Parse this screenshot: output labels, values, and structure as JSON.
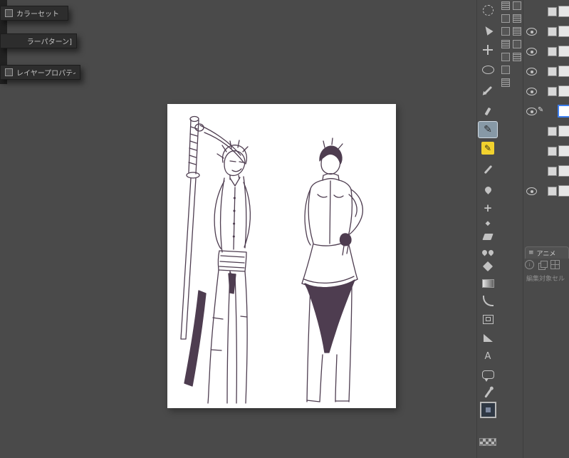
{
  "colors": {
    "workspace_bg": "#4a4a4a",
    "panel_bg": "#2d2d2d",
    "selected_tool_bg": "#8799a6",
    "pencil_icon_yellow": "#f2d22e",
    "layer_selection_blue": "#3d7ff0",
    "canvas_white": "#ffffff",
    "line_art": "#4e3d50"
  },
  "left_panels": [
    {
      "label": "カラーセット"
    },
    {
      "label": "ラーパターン]"
    },
    {
      "label": "レイヤープロパティ"
    }
  ],
  "toolbar": {
    "selected_tool": "pen",
    "text_tool_label": "A",
    "tools": [
      "rotate",
      "select-cursor",
      "move",
      "lasso",
      "eyedropper",
      "marker",
      "pen",
      "pencil",
      "brush",
      "airbrush",
      "decoration",
      "sub-tool",
      "eraser",
      "blend",
      "fill",
      "gradient",
      "curve",
      "frame",
      "ruler",
      "text",
      "balloon",
      "line-correction",
      "color-swatch",
      "transparent-color"
    ]
  },
  "layer_panel": {
    "rows": [
      {
        "eye": false,
        "selected": false
      },
      {
        "eye": true,
        "selected": false
      },
      {
        "eye": true,
        "selected": false
      },
      {
        "eye": true,
        "selected": false
      },
      {
        "eye": true,
        "selected": false
      },
      {
        "eye": true,
        "selected": true,
        "mark": "pencil"
      },
      {
        "eye": false,
        "selected": false
      },
      {
        "eye": false,
        "selected": false
      },
      {
        "eye": false,
        "selected": false
      },
      {
        "eye": true,
        "selected": false
      }
    ]
  },
  "animation": {
    "tab_label": "アニメ",
    "cell_label": "編集対象セル"
  }
}
